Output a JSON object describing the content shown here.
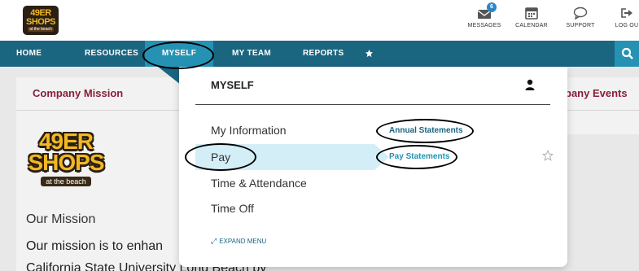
{
  "logo": {
    "line1": "49ER",
    "line2": "SHOPS",
    "line3": "at the beach"
  },
  "utility_nav": [
    {
      "label": "MESSAGES",
      "icon": "envelope-icon",
      "badge": "6"
    },
    {
      "label": "CALENDAR",
      "icon": "calendar-icon"
    },
    {
      "label": "SUPPORT",
      "icon": "chat-bubble-icon"
    },
    {
      "label": "LOG OU",
      "icon": "logout-icon"
    }
  ],
  "main_nav": {
    "items": [
      "HOME",
      "RESOURCES",
      "MYSELF",
      "MY TEAM",
      "REPORTS"
    ],
    "active": "MYSELF",
    "favorites_icon": "star-icon",
    "search_icon": "search-icon"
  },
  "background": {
    "left_panel_title": "Company Mission",
    "right_panel_title": "pany Events",
    "mission_heading": "Our Mission",
    "mission_line1": "Our mission is to enhan",
    "mission_line2": "California State University Long Beach by"
  },
  "dropdown": {
    "title": "MYSELF",
    "items": [
      "My Information",
      "Pay",
      "Time & Attendance",
      "Time Off"
    ],
    "highlighted_item": "Pay",
    "sub_items": [
      "Annual Statements",
      "Pay Statements"
    ],
    "selected_sub_item": "Pay Statements",
    "expand_label": "EXPAND MENU"
  },
  "colors": {
    "nav_bg": "#1a6580",
    "nav_active": "#2592b3",
    "panel_title": "#8a1d3a",
    "highlight": "#d4eef7",
    "logo_gold": "#f2b824"
  }
}
